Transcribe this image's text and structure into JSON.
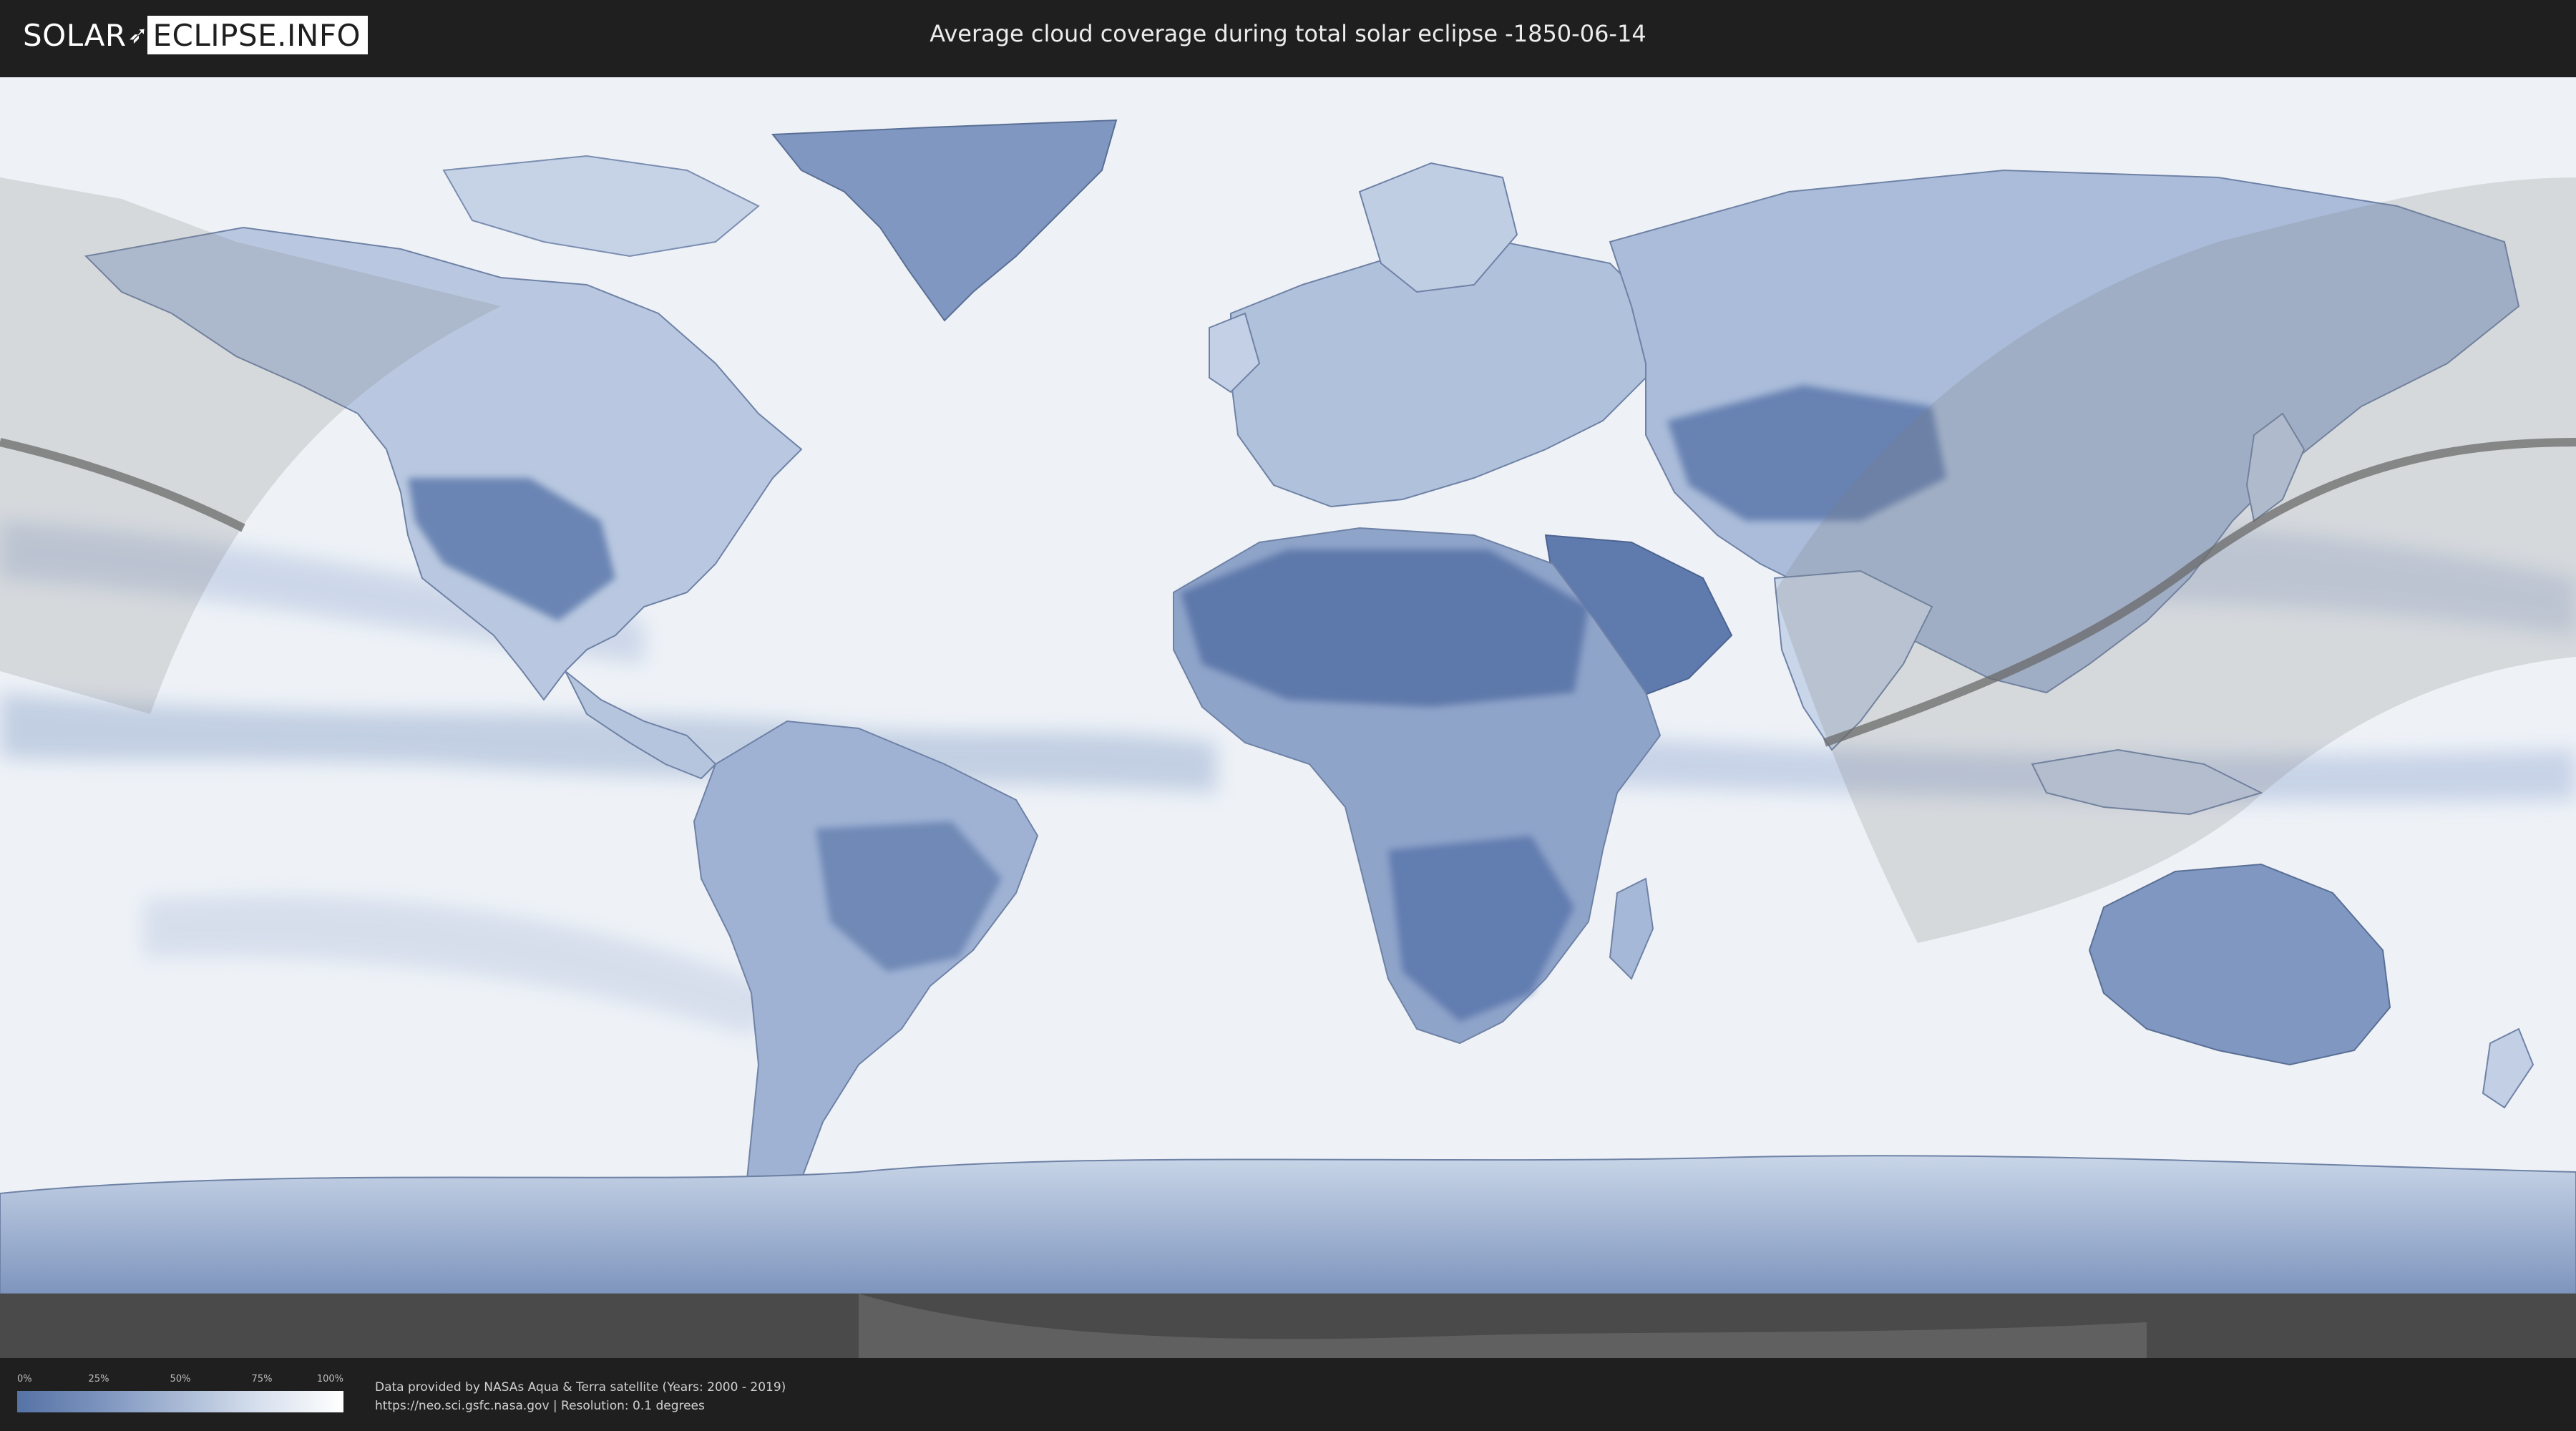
{
  "header": {
    "logo_left": "SOLAR",
    "logo_right": "ECLIPSE.INFO",
    "title": "Average cloud coverage during total solar eclipse -1850-06-14"
  },
  "legend": {
    "ticks": [
      "0%",
      "25%",
      "50%",
      "75%",
      "100%"
    ],
    "colors": {
      "low": "#5673a6",
      "high": "#ffffff"
    }
  },
  "credits": {
    "line1": "Data provided by NASAs Aqua & Terra satellite (Years: 2000 - 2019)",
    "line2": "https://neo.sci.gsfc.nasa.gov | Resolution: 0.1 degrees"
  },
  "map": {
    "projection": "equirectangular",
    "layer": "cloud coverage",
    "colors": {
      "ocean_cloudy": "#f2f5f9",
      "land_clear": "#5e7aad",
      "land_mid": "#8ea4c8",
      "eclipse_overlay": "#808080",
      "central_line": "#6a6a6a"
    }
  }
}
